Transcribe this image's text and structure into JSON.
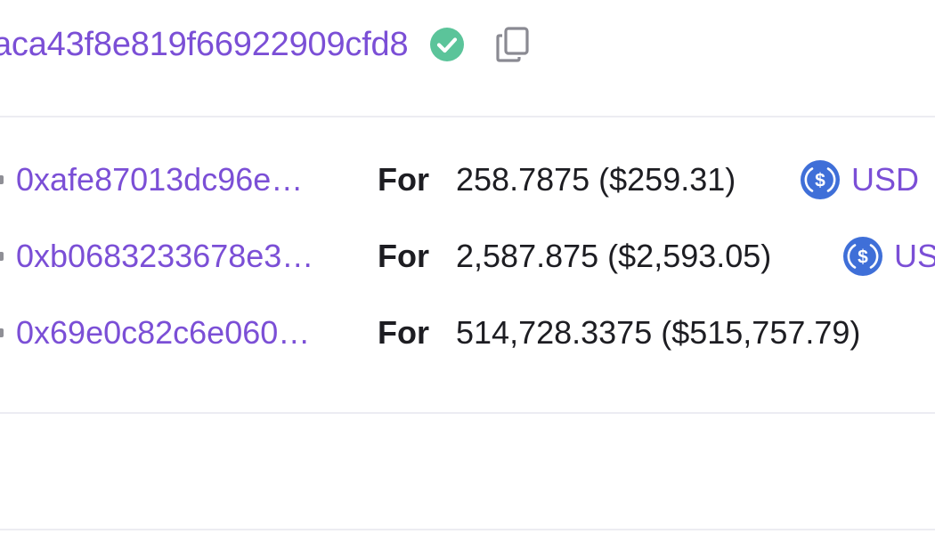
{
  "transaction": {
    "hash_visible": "aca43f8e819f66922909cfd8",
    "status_icon": "check-circle-icon",
    "copy_icon": "copy-icon"
  },
  "transfers": [
    {
      "address": "0xafe87013dc96e…",
      "for_label": "For",
      "amount": "258.7875 ($259.31)",
      "token_icon": "usdc-icon",
      "token_symbol": "USD"
    },
    {
      "address": "0xb0683233678e3…",
      "for_label": "For",
      "amount": "2,587.875 ($2,593.05)",
      "token_icon": "usdc-icon",
      "token_symbol": "US"
    },
    {
      "address": "0x69e0c82c6e060…",
      "for_label": "For",
      "amount": "514,728.3375 ($515,757.79)"
    }
  ],
  "colors": {
    "link_purple": "#7b4fd6",
    "success_green": "#5bc49a",
    "usdc_blue": "#3f6fd8",
    "divider": "#ececf2",
    "text_dark": "#1d1d22"
  }
}
